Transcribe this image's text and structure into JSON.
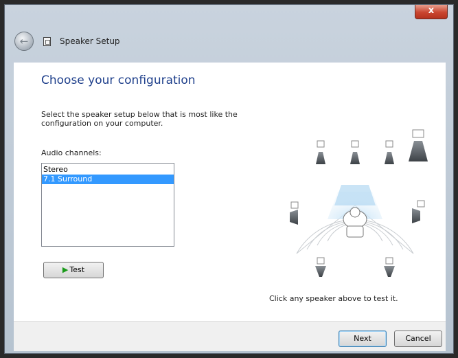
{
  "window": {
    "title": "Speaker Setup",
    "close_label": "x"
  },
  "page": {
    "heading": "Choose your configuration",
    "instructions": "Select the speaker setup below that is most like the configuration on your computer.",
    "channels_label": "Audio channels:",
    "channels": [
      {
        "label": "Stereo",
        "selected": false
      },
      {
        "label": "7.1 Surround",
        "selected": true
      }
    ],
    "test_label": "Test",
    "hint": "Click any speaker above to test it."
  },
  "footer": {
    "next_label": "Next",
    "cancel_label": "Cancel"
  },
  "colors": {
    "heading": "#1e3f8b",
    "selection": "#3399ff",
    "play": "#1a9a1a",
    "close": "#c9452f"
  },
  "icons": {
    "back": "back-arrow-icon",
    "title": "speaker-setup-icon",
    "play": "play-icon",
    "speakers": "speaker-icon"
  }
}
